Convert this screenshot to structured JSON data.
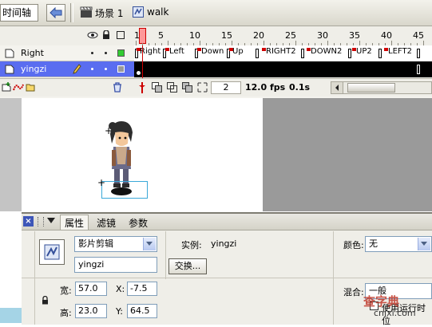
{
  "toolbar": {
    "timeline_label": "时间轴",
    "scene_label": "场景 1",
    "symbol_label": "walk"
  },
  "timeline": {
    "frame_numbers": [
      "1",
      "5",
      "10",
      "15",
      "20",
      "25",
      "30",
      "35",
      "40",
      "45"
    ],
    "layers": [
      {
        "name": "Right",
        "selected": false
      },
      {
        "name": "yingzi",
        "selected": true
      }
    ],
    "frame_labels": [
      "Right",
      "Left",
      "Down",
      "Up",
      "RIGHT2",
      "DOWN2",
      "UP2",
      "LEFT2"
    ],
    "current_frame": "2",
    "fps": "12.0 fps",
    "elapsed": "0.1s"
  },
  "properties": {
    "tabs": [
      "属性",
      "滤镜",
      "参数"
    ],
    "symbol_type": "影片剪辑",
    "instance_name": "yingzi",
    "instance_label": "实例:",
    "instance_value": "yingzi",
    "swap_button": "交换...",
    "color_label": "颜色:",
    "color_value": "无",
    "width_label": "宽:",
    "width_value": "57.0",
    "height_label": "高:",
    "height_value": "23.0",
    "x_label": "X:",
    "x_value": "-7.5",
    "y_label": "Y:",
    "y_value": "64.5",
    "blend_label": "混合:",
    "blend_value": "一般",
    "runtime_label": "使用运行时位"
  },
  "watermark": {
    "text": "查字典",
    "url": "cnjxl.com"
  },
  "colors": {
    "selected_layer": "#5a6df0",
    "playhead": "#ff9999",
    "frame_flag": "#d00000"
  }
}
